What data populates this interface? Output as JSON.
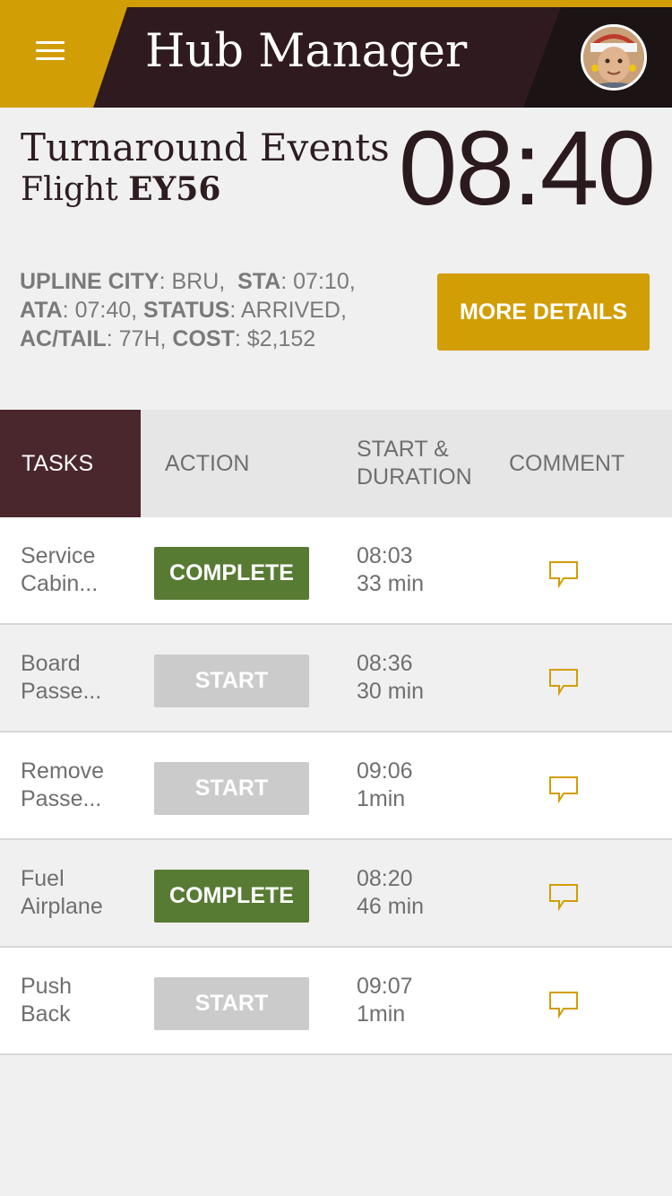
{
  "header": {
    "title": "Hub Manager",
    "menu_icon": "hamburger-menu-icon",
    "avatar_icon": "user-avatar"
  },
  "flight": {
    "events_title": "Turnaround Events",
    "flight_prefix": "Flight",
    "flight_number": "EY56",
    "clock": "08:40"
  },
  "details": {
    "upline_city_label": "UPLINE CITY",
    "upline_city_value": ": BRU,",
    "sta_label": "STA",
    "sta_value": ": 07:10,",
    "ata_label": "ATA",
    "ata_value": ": 07:40,",
    "status_label": "STATUS",
    "status_value": ": ARRIVED,",
    "actail_label": "AC/TAIL",
    "actail_value": ": 77H,",
    "cost_label": "COST",
    "cost_value": ": $2,152",
    "more_button": "MORE DETAILS"
  },
  "table": {
    "columns": [
      "TASKS",
      "ACTION",
      "START &\nDURATION",
      "COMMENT"
    ],
    "rows": [
      {
        "task": "Service\nCabin...",
        "action": "COMPLETE",
        "start": "08:03",
        "duration": "33 min"
      },
      {
        "task": "Board\nPasse...",
        "action": "START",
        "start": "08:36",
        "duration": "30 min"
      },
      {
        "task": "Remove\nPasse...",
        "action": "START",
        "start": "09:06",
        "duration": "1min"
      },
      {
        "task": "Fuel\nAirplane",
        "action": "COMPLETE",
        "start": "08:20",
        "duration": "46 min"
      },
      {
        "task": "Push\nBack",
        "action": "START",
        "start": "09:07",
        "duration": "1min"
      }
    ]
  },
  "colors": {
    "accent": "#d29e05",
    "dark": "#2f1b1f",
    "active_tab": "#4a262d",
    "complete": "#577b33",
    "start": "#cbcbcb"
  }
}
